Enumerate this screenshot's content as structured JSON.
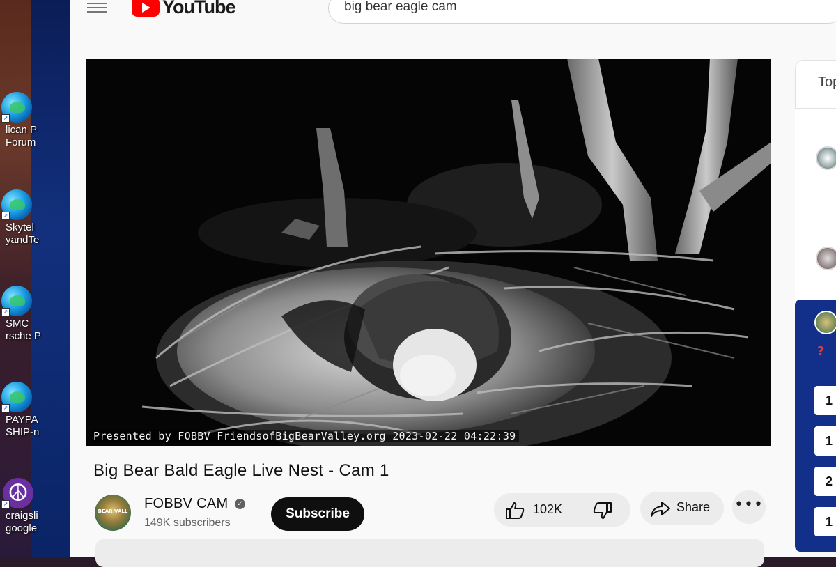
{
  "desktop": {
    "icons": [
      {
        "label_lines": [
          "lican P",
          "Forum"
        ],
        "icon": "edge-browser-icon"
      },
      {
        "label_lines": [
          "Skytel",
          "yandTe"
        ],
        "icon": "edge-browser-icon"
      },
      {
        "label_lines": [
          "SMC",
          "rsche P"
        ],
        "icon": "edge-browser-icon"
      },
      {
        "label_lines": [
          "PAYPA",
          "SHIP-n"
        ],
        "icon": "edge-browser-icon"
      },
      {
        "label_lines": [
          "craigsli",
          "google"
        ],
        "icon": "peace-sign-icon"
      }
    ]
  },
  "header": {
    "logo_text": "YouTube",
    "search_query": "big bear eagle cam"
  },
  "video": {
    "overlay_text": "Presented by FOBBV FriendsofBigBearValley.org 2023-02-22 04:22:39",
    "title": "Big Bear Bald Eagle Live Nest - Cam 1"
  },
  "channel": {
    "name": "FOBBV CAM",
    "subscribers": "149K subscribers",
    "avatar_text": "BEAR VALL"
  },
  "actions": {
    "subscribe_label": "Subscribe",
    "like_count": "102K",
    "share_label": "Share",
    "more_label": "•••"
  },
  "sidebar": {
    "tab_partial": "Top",
    "panel_question": "?",
    "panel_buttons": [
      "1",
      "1",
      "2",
      "1"
    ]
  },
  "colors": {
    "youtube_red": "#ff0000",
    "subscribe_bg": "#0f0f0f",
    "panel_blue": "#12308a"
  }
}
